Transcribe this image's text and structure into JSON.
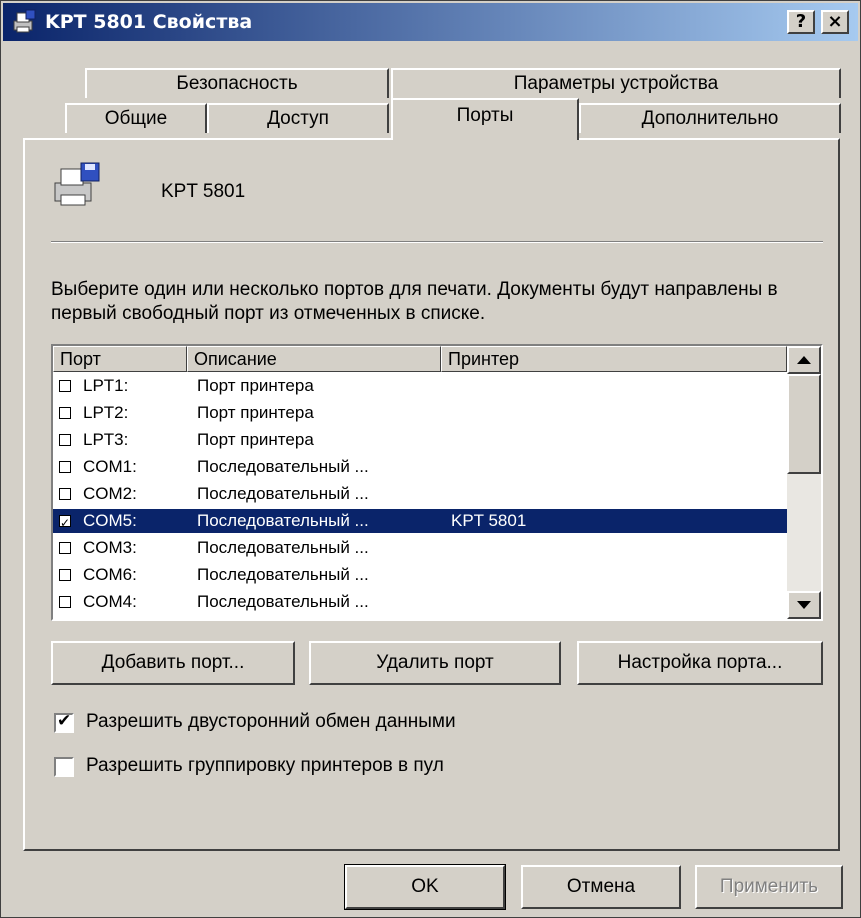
{
  "window": {
    "title": "KPT 5801 Свойства",
    "help_btn": "?",
    "close_btn": "×"
  },
  "tabs_back": [
    "Безопасность",
    "Параметры устройства"
  ],
  "tabs_front": [
    "Общие",
    "Доступ",
    "Порты",
    "Дополнительно"
  ],
  "active_tab": "Порты",
  "printer_name": "KPT 5801",
  "description": "Выберите один или несколько портов для печати. Документы будут направлены в первый свободный порт из отмеченных в списке.",
  "ports_list": {
    "columns": [
      "Порт",
      "Описание",
      "Принтер"
    ],
    "rows": [
      {
        "checked": false,
        "port": "LPT1:",
        "desc": "Порт принтера",
        "printer": ""
      },
      {
        "checked": false,
        "port": "LPT2:",
        "desc": "Порт принтера",
        "printer": ""
      },
      {
        "checked": false,
        "port": "LPT3:",
        "desc": "Порт принтера",
        "printer": ""
      },
      {
        "checked": false,
        "port": "COM1:",
        "desc": "Последовательный ...",
        "printer": ""
      },
      {
        "checked": false,
        "port": "COM2:",
        "desc": "Последовательный ...",
        "printer": ""
      },
      {
        "checked": true,
        "port": "COM5:",
        "desc": "Последовательный ...",
        "printer": "KPT 5801",
        "selected": true
      },
      {
        "checked": false,
        "port": "COM3:",
        "desc": "Последовательный ...",
        "printer": ""
      },
      {
        "checked": false,
        "port": "COM6:",
        "desc": "Последовательный ...",
        "printer": ""
      },
      {
        "checked": false,
        "port": "COM4:",
        "desc": "Последовательный ...",
        "printer": ""
      }
    ]
  },
  "port_buttons": {
    "add": "Добавить порт...",
    "delete": "Удалить порт",
    "configure": "Настройка порта..."
  },
  "options": {
    "bidirectional": {
      "label": "Разрешить двусторонний обмен данными",
      "checked": true
    },
    "pooling": {
      "label": "Разрешить группировку принтеров в пул",
      "checked": false
    }
  },
  "footer": {
    "ok": "OK",
    "cancel": "Отмена",
    "apply": "Применить"
  },
  "colors": {
    "title_start": "#0a246a",
    "title_end": "#a6caf0",
    "face": "#d4d0c8",
    "selection": "#0a246a"
  }
}
